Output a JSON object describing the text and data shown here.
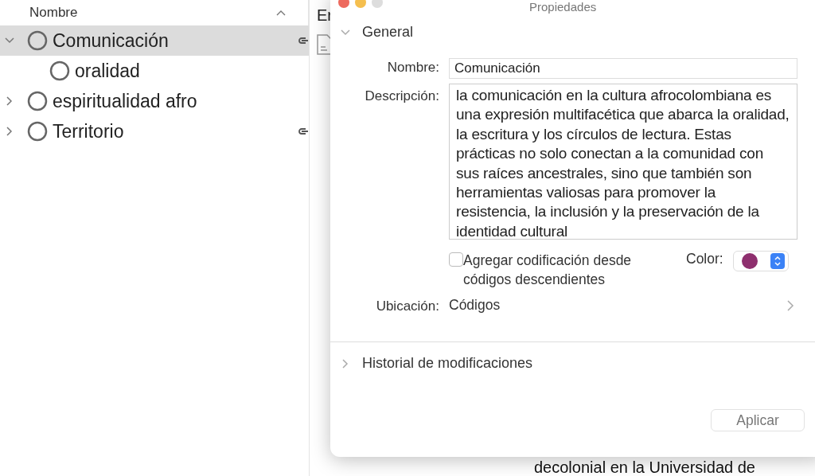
{
  "tree": {
    "column_header": "Nombre",
    "items": [
      {
        "label": "Comunicación",
        "selected": true,
        "expanded": true,
        "linked": true,
        "children": [
          {
            "label": "oralidad",
            "selected": false,
            "linked": false
          }
        ]
      },
      {
        "label": "espiritualidad afro",
        "selected": false,
        "expanded": false,
        "linked": false
      },
      {
        "label": "Territorio",
        "selected": false,
        "expanded": false,
        "linked": true
      }
    ]
  },
  "middle_pane": {
    "header": "Er",
    "background_text": "decolonial en la Universidad de"
  },
  "dialog": {
    "title": "Propiedades",
    "general": {
      "label": "General",
      "expanded": true,
      "name_label": "Nombre:",
      "name_value": "Comunicación",
      "description_label": "Descripción:",
      "description_value": "la comunicación en la cultura afrocolombiana es una expresión multifacética que abarca la oralidad, la escritura y los círculos de lectura. Estas prácticas no solo conectan a la comunidad con sus raíces ancestrales, sino que también son herramientas valiosas para promover la resistencia, la inclusión y la preservación de la identidad cultural",
      "checkbox_label": "Agregar codificación desde códigos descendientes",
      "checkbox_checked": false,
      "color_label": "Color:",
      "color": "#8e2f6e",
      "location_label": "Ubicación:",
      "location_value": "Códigos"
    },
    "history": {
      "label": "Historial de modificaciones",
      "expanded": false
    },
    "apply_button": {
      "label": "Aplicar",
      "disabled": true
    }
  }
}
